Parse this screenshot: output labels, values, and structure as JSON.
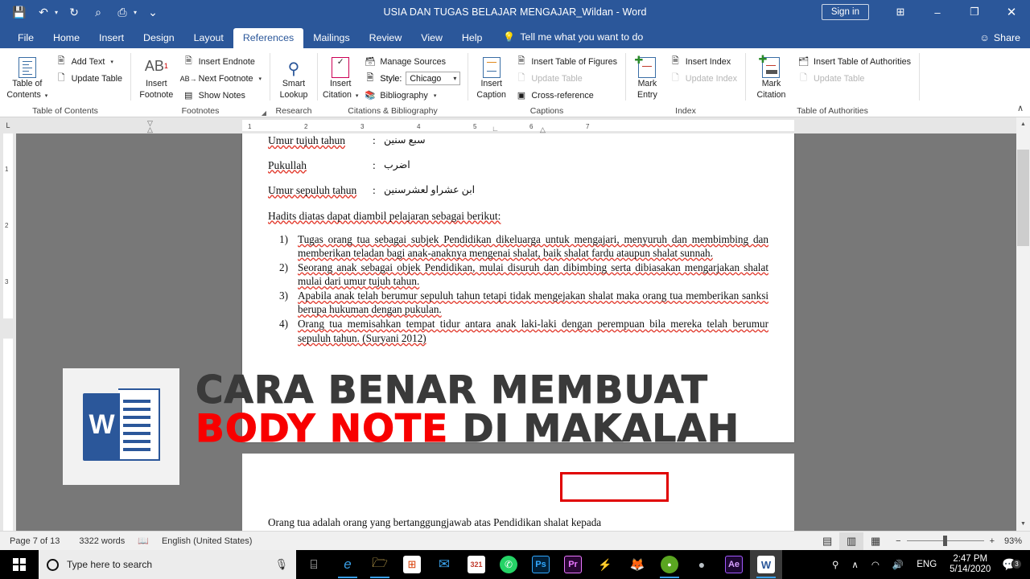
{
  "titlebar": {
    "document_title": "USIA DAN TUGAS BELAJAR MENGAJAR_Wildan  -  Word",
    "quick_access": [
      {
        "name": "save-icon",
        "glyph": "💾"
      },
      {
        "name": "undo-icon",
        "glyph": "↶"
      },
      {
        "name": "redo-icon",
        "glyph": "↻"
      },
      {
        "name": "zoom-icon",
        "glyph": "⌕"
      },
      {
        "name": "print-preview-icon",
        "glyph": "⎙"
      },
      {
        "name": "customize-qat-icon",
        "glyph": "⌄"
      }
    ],
    "sign_in": "Sign in",
    "ribbon_display_options": "⊞",
    "minimize": "–",
    "restore": "❐",
    "close": "✕"
  },
  "tabs": {
    "items": [
      "File",
      "Home",
      "Insert",
      "Design",
      "Layout",
      "References",
      "Mailings",
      "Review",
      "View",
      "Help"
    ],
    "active": "References",
    "tell_me": "Tell me what you want to do",
    "share": "Share"
  },
  "ribbon": {
    "groups": [
      {
        "name": "table-of-contents",
        "label": "Table of Contents",
        "big_button": {
          "line1": "Table of",
          "line2": "Contents",
          "has_caret": true
        },
        "small_buttons": [
          {
            "label": "Add Text",
            "caret": true,
            "disabled": false
          },
          {
            "label": "Update Table",
            "caret": false,
            "disabled": false
          }
        ]
      },
      {
        "name": "footnotes",
        "label": "Footnotes",
        "big_button": {
          "line1": "Insert",
          "line2": "Footnote",
          "glyph": "AB"
        },
        "small_buttons": [
          {
            "label": "Insert Endnote",
            "caret": false,
            "disabled": false
          },
          {
            "label": "Next Footnote",
            "caret": true,
            "disabled": false
          },
          {
            "label": "Show Notes",
            "caret": false,
            "disabled": false
          }
        ],
        "has_dialog_launcher": true
      },
      {
        "name": "research",
        "label": "Research",
        "big_button": {
          "line1": "Smart",
          "line2": "Lookup"
        }
      },
      {
        "name": "citations-bibliography",
        "label": "Citations & Bibliography",
        "big_button": {
          "line1": "Insert",
          "line2": "Citation",
          "has_caret": true
        },
        "small_buttons": [
          {
            "label": "Manage Sources",
            "caret": false,
            "disabled": false
          },
          {
            "label": "Bibliography",
            "caret": true,
            "disabled": false
          }
        ],
        "style_label": "Style:",
        "style_value": "Chicago"
      },
      {
        "name": "captions",
        "label": "Captions",
        "big_button": {
          "line1": "Insert",
          "line2": "Caption"
        },
        "small_buttons": [
          {
            "label": "Insert Table of Figures",
            "caret": false,
            "disabled": false
          },
          {
            "label": "Update Table",
            "caret": false,
            "disabled": true
          },
          {
            "label": "Cross-reference",
            "caret": false,
            "disabled": false
          }
        ]
      },
      {
        "name": "index",
        "label": "Index",
        "big_button": {
          "line1": "Mark",
          "line2": "Entry"
        },
        "small_buttons": [
          {
            "label": "Insert Index",
            "caret": false,
            "disabled": false
          },
          {
            "label": "Update Index",
            "caret": false,
            "disabled": true
          }
        ]
      },
      {
        "name": "table-of-authorities",
        "label": "Table of Authorities",
        "big_button": {
          "line1": "Mark",
          "line2": "Citation"
        },
        "small_buttons": [
          {
            "label": "Insert Table of Authorities",
            "caret": false,
            "disabled": false
          },
          {
            "label": "Update Table",
            "caret": false,
            "disabled": true
          }
        ]
      }
    ],
    "collapse_ribbon": "∧"
  },
  "ruler": {
    "corner_tab": "L",
    "h_marks": [
      "1",
      "2",
      "3",
      "4",
      "5",
      "6",
      "7"
    ],
    "v_marks": [
      "1",
      "2",
      "3"
    ]
  },
  "document": {
    "glossary": [
      {
        "term": "Umur tujuh tahun",
        "sep": ":",
        "arabic": "سبع سنين"
      },
      {
        "term": "Pukullah",
        "sep": ":",
        "arabic": "اضرب"
      },
      {
        "term": "Umur sepuluh tahun",
        "sep": ":",
        "arabic": "ابن عشراو لعشرسنين"
      }
    ],
    "intro": "Hadits diatas dapat diambil pelajaran sebagai berikut:",
    "list": [
      {
        "num": "1)",
        "text": "Tugas orang tua sebagai subjek Pendidikan dikeluarga untuk mengajari, menyuruh dan membimbing dan memberikan teladan bagi anak-anaknya mengenai shalat, baik shalat fardu ataupun shalat sunnah."
      },
      {
        "num": "2)",
        "text": "Seorang anak sebagai objek Pendidikan, mulai disuruh dan dibimbing serta dibiasakan mengarjakan shalat mulai dari umur tujuh tahun."
      },
      {
        "num": "3)",
        "text": "Apabila anak telah berumur sepuluh tahun tetapi tidak mengejakan shalat maka orang tua memberikan sanksi berupa hukuman dengan pukulan."
      },
      {
        "num": "4)",
        "text": "Orang tua memisahkan tempat tidur antara anak laki-laki dengan perempuan bila mereka telah berumur sepuluh tahun. (Suryani 2012)"
      }
    ],
    "next_page_text": "Orang tua adalah orang yang bertanggungjawab atas Pendidikan shalat kepada",
    "highlight_color": "#e00000"
  },
  "overlay": {
    "logo_letter": "W",
    "line1": "CARA BENAR MEMBUAT",
    "line2_red": "BODY NOTE",
    "line2_rest": " DI MAKALAH",
    "red_color": "#f80000",
    "dark_color": "#3a3a3a"
  },
  "statusbar": {
    "page": "Page 7 of 13",
    "words": "3322 words",
    "proofing_icon": "📖",
    "language": "English (United States)",
    "views": [
      {
        "name": "read-mode",
        "glyph": "▤",
        "selected": false
      },
      {
        "name": "print-layout",
        "glyph": "▥",
        "selected": true
      },
      {
        "name": "web-layout",
        "glyph": "▦",
        "selected": false
      }
    ],
    "zoom_out": "−",
    "zoom_in": "+",
    "zoom_value": "93%"
  },
  "taskbar": {
    "search_placeholder": "Type here to search",
    "mic_icon": "🎙",
    "task_view_icon": "⌸",
    "apps": [
      {
        "name": "edge-icon",
        "label": "e",
        "bg": "transparent",
        "color": "#3aa0e8",
        "open": true
      },
      {
        "name": "file-explorer-icon",
        "label": "🗁",
        "bg": "transparent",
        "color": "#ffd666",
        "open": true
      },
      {
        "name": "microsoft-store-icon",
        "label": "⊞",
        "bg": "#ffffff",
        "color": "#d83b01",
        "open": false
      },
      {
        "name": "mail-icon",
        "label": "✉",
        "bg": "transparent",
        "color": "#3aa0e8",
        "open": false
      },
      {
        "name": "video-editor-icon",
        "label": "321",
        "bg": "transparent",
        "color": "#ffffff",
        "open": false
      },
      {
        "name": "whatsapp-icon",
        "label": "✆",
        "bg": "#25d366",
        "color": "#ffffff",
        "open": false
      },
      {
        "name": "photoshop-icon",
        "label": "Ps",
        "bg": "#001e36",
        "color": "#31a8ff",
        "open": false
      },
      {
        "name": "premiere-icon",
        "label": "Pr",
        "bg": "#2a0634",
        "color": "#ea77ff",
        "open": false
      },
      {
        "name": "lightning-icon",
        "label": "⚡",
        "bg": "transparent",
        "color": "#ffffff",
        "open": false
      },
      {
        "name": "firefox-icon",
        "label": "🦊",
        "bg": "transparent",
        "color": "#ff7139",
        "open": false
      },
      {
        "name": "green-app-icon",
        "label": "●",
        "bg": "#5aa521",
        "color": "#ffffff",
        "open": true
      },
      {
        "name": "gray-app-icon",
        "label": "●",
        "bg": "transparent",
        "color": "#b9c0c5",
        "open": false
      },
      {
        "name": "after-effects-icon",
        "label": "Ae",
        "bg": "#1d0733",
        "color": "#d6a1ff",
        "open": false
      },
      {
        "name": "word-icon",
        "label": "W",
        "bg": "#ffffff",
        "color": "#2b579a",
        "open": true,
        "active": true
      }
    ],
    "tray": [
      {
        "name": "people-icon",
        "glyph": "⚲"
      },
      {
        "name": "show-hidden-icons",
        "glyph": "∧"
      },
      {
        "name": "wifi-icon",
        "glyph": "◠"
      },
      {
        "name": "volume-icon",
        "glyph": "🔊"
      },
      {
        "name": "language-indicator",
        "glyph": "ENG"
      }
    ],
    "time": "2:47 PM",
    "date": "5/14/2020",
    "notification_count": "3"
  }
}
